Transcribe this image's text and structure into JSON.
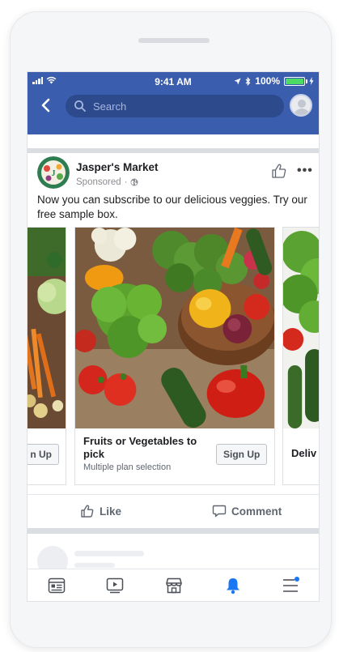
{
  "status_bar": {
    "time": "9:41 AM",
    "battery": "100%"
  },
  "header": {
    "search_placeholder": "Search"
  },
  "post": {
    "page_name": "Jasper's Market",
    "sponsored": "Sponsored",
    "text": "Now you can subscribe to our delicious veggies. Try our free sample box."
  },
  "carousel": {
    "left_card": {
      "cta": "n Up"
    },
    "main_card": {
      "title": "Fruits or Vegetables to pick",
      "subtitle": "Multiple plan selection",
      "cta": "Sign Up"
    },
    "right_card": {
      "title": "Deliv"
    }
  },
  "actions": {
    "like": "Like",
    "comment": "Comment"
  },
  "tabs": [
    "news-feed",
    "watch",
    "marketplace",
    "notifications",
    "menu"
  ],
  "colors": {
    "brand": "#3b5dae",
    "accent": "#1877f2",
    "battery": "#4cd964"
  }
}
